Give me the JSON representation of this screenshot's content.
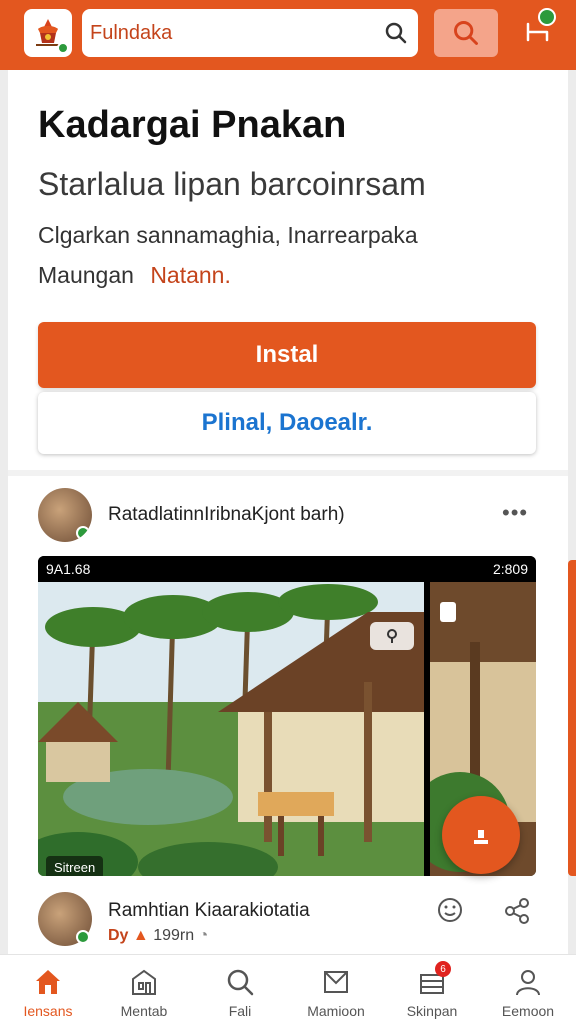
{
  "colors": {
    "brand": "#e3571f",
    "link": "#1b74d0",
    "online": "#2c9a3c"
  },
  "header": {
    "search_value": "Fulndaka",
    "logo_icon": "temple-logo-icon",
    "search_icon": "search-icon",
    "cart_icon": "cart-icon"
  },
  "app": {
    "title": "Kadargai Pnakan",
    "subtitle": "Starlalua lipan barcoinrsam",
    "description": "Clgarkan sannamaghia, Inarrearpaka",
    "meta_label": "Maungan",
    "meta_value": "Natann.",
    "install_label": "Instal",
    "secondary_label": "Plinal, Daoealr."
  },
  "post": {
    "author": "RatadlatinnIribnaKjont barh)",
    "more_icon": "more-icon",
    "status_time": "9A1.68",
    "status_right": "2:809",
    "media_label": "Sitreen",
    "fab_icon": "upload-icon"
  },
  "post2": {
    "title": "Ramhtian Kiaarakiotatia",
    "meta_prefix": "Dy",
    "meta_value": "199rn",
    "like_icon": "like-icon",
    "share_icon": "share-icon"
  },
  "nav": {
    "items": [
      {
        "label": "Iensans",
        "icon": "home-icon",
        "active": true
      },
      {
        "label": "Mentab",
        "icon": "store-icon"
      },
      {
        "label": "Fali",
        "icon": "search-icon"
      },
      {
        "label": "Mamioon",
        "icon": "mail-icon"
      },
      {
        "label": "Skinpan",
        "icon": "stack-icon",
        "badge": "6"
      },
      {
        "label": "Eemoon",
        "icon": "profile-icon"
      }
    ]
  }
}
